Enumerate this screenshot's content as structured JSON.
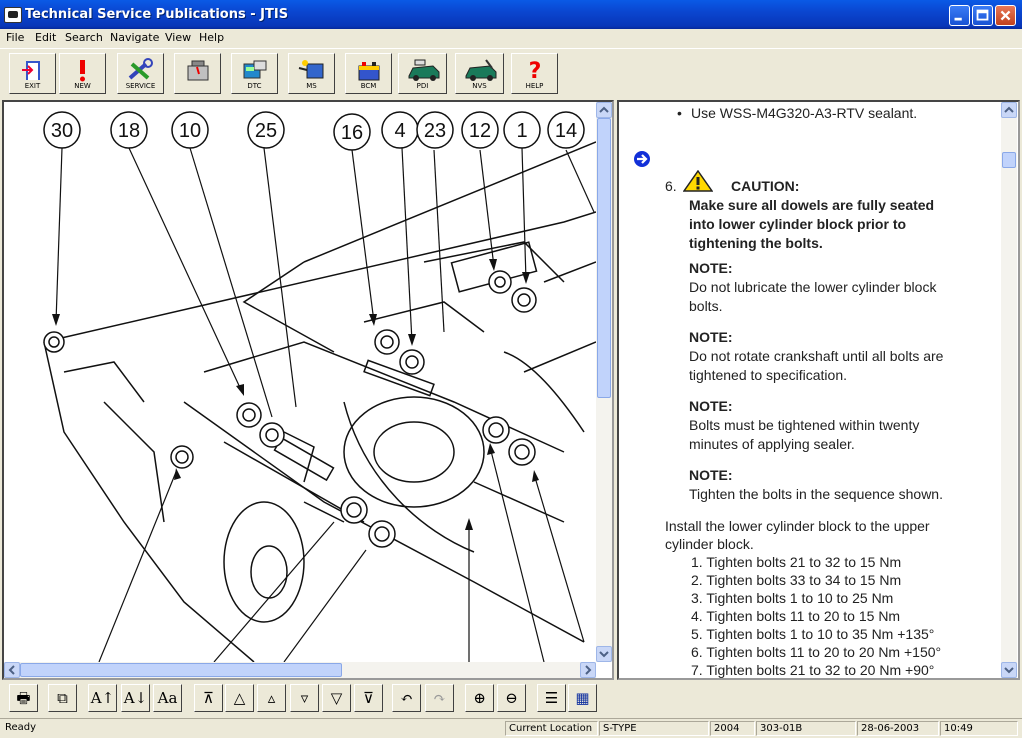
{
  "window": {
    "title": "Technical Service Publications - JTIS"
  },
  "menu": [
    "File",
    "Edit",
    "Search",
    "Navigate",
    "View",
    "Help"
  ],
  "toolbar": [
    {
      "label": "EXIT",
      "icon": "exit-door-icon"
    },
    {
      "label": "NEW",
      "icon": "exclamation-icon"
    },
    {
      "label": "SERVICE",
      "icon": "wrench-icon"
    },
    {
      "label": "",
      "icon": "engine-icon"
    },
    {
      "label": "DTC",
      "icon": "dtc-scanner-icon"
    },
    {
      "label": "MS",
      "icon": "ms-oilcan-icon"
    },
    {
      "label": "BCM",
      "icon": "battery-icon"
    },
    {
      "label": "PDI",
      "icon": "car-pdi-icon"
    },
    {
      "label": "NVS",
      "icon": "car-nvs-icon"
    },
    {
      "label": "HELP",
      "icon": "help-question-icon"
    }
  ],
  "diagram": {
    "callouts": [
      "30",
      "18",
      "10",
      "25",
      "16",
      "4",
      "23",
      "12",
      "1",
      "14"
    ]
  },
  "document": {
    "bullet": "Use WSS-M4G320-A3-RTV sealant.",
    "step_number": "6.",
    "caution_title": "CAUTION:",
    "caution_lines": [
      "Make sure all dowels are fully seated",
      "into lower cylinder block prior to",
      "tightening the bolts."
    ],
    "notes": [
      {
        "title": "NOTE:",
        "lines": [
          "Do not lubricate the lower cylinder block",
          "bolts."
        ]
      },
      {
        "title": "NOTE:",
        "lines": [
          "Do not rotate crankshaft until all bolts are",
          "tightened to specification."
        ]
      },
      {
        "title": "NOTE:",
        "lines": [
          "Bolts must be tightened within twenty",
          "minutes of applying sealer."
        ]
      },
      {
        "title": "NOTE:",
        "lines": [
          "Tighten the bolts in the sequence shown."
        ]
      }
    ],
    "install_lines": [
      "Install the lower cylinder block to the upper",
      "cylinder block."
    ],
    "steps": [
      "1. Tighten bolts 21 to 32 to 15 Nm",
      "2. Tighten bolts 33 to 34 to 15 Nm",
      "3. Tighten bolts 1 to 10 to 25 Nm",
      "4. Tighten bolts 11 to 20 to 15 Nm",
      "5. Tighten bolts 1 to 10 to 35 Nm +135°",
      "6. Tighten bolts 11 to 20 to 20 Nm +150°",
      "7. Tighten bolts 21 to 32 to 20 Nm +90°"
    ]
  },
  "bottom_toolbar": [
    {
      "name": "print-icon",
      "glyph": "🖶"
    },
    {
      "name": "copy-icon",
      "glyph": "⧉"
    },
    {
      "name": "font-increase-icon",
      "glyph": "A↑"
    },
    {
      "name": "font-decrease-icon",
      "glyph": "A↓"
    },
    {
      "name": "font-style-icon",
      "glyph": "Aa"
    },
    {
      "name": "first-page-icon",
      "glyph": "⊼"
    },
    {
      "name": "previous-section-icon",
      "glyph": "△"
    },
    {
      "name": "previous-page-icon",
      "glyph": "▵"
    },
    {
      "name": "next-page-icon",
      "glyph": "▿"
    },
    {
      "name": "next-section-icon",
      "glyph": "▽"
    },
    {
      "name": "last-page-icon",
      "glyph": "⊽"
    },
    {
      "name": "back-icon",
      "glyph": "↶"
    },
    {
      "name": "forward-icon",
      "glyph": "↷"
    },
    {
      "name": "zoom-in-icon",
      "glyph": "⊕"
    },
    {
      "name": "zoom-out-icon",
      "glyph": "⊖"
    },
    {
      "name": "list-view-icon",
      "glyph": "☰"
    },
    {
      "name": "grid-view-icon",
      "glyph": "▦"
    }
  ],
  "status": {
    "ready": "Ready",
    "location_label": "Current Location",
    "model": "S-TYPE",
    "year": "2004",
    "section": "303-01B",
    "date": "28-06-2003",
    "time": "10:49"
  },
  "colors": {
    "titlebar": "#0a46d0",
    "caution_yellow": "#ffd800",
    "arrow_blue": "#1230d8"
  }
}
